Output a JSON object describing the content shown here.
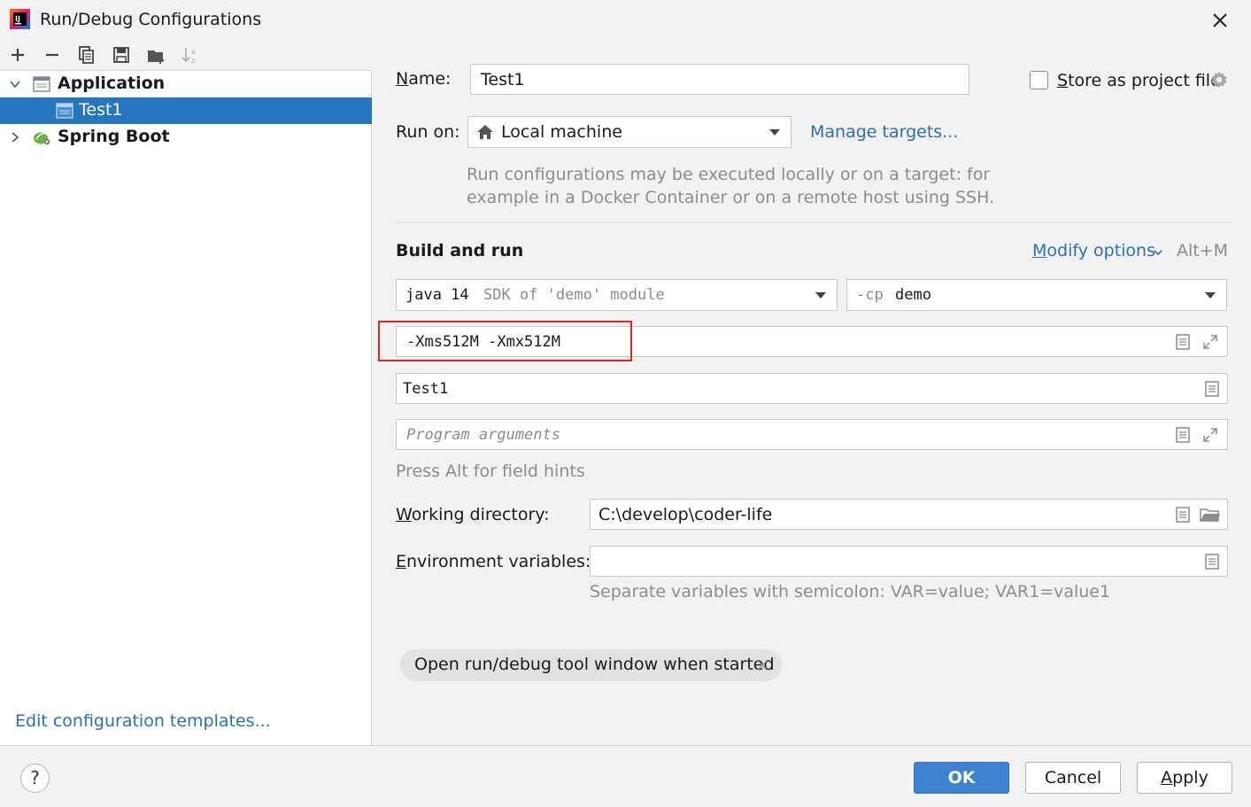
{
  "window": {
    "title": "Run/Debug Configurations"
  },
  "tree": {
    "items": [
      {
        "label": "Application",
        "expanded": true
      },
      {
        "label": "Test1",
        "selected": true
      },
      {
        "label": "Spring Boot",
        "expanded": false
      }
    ]
  },
  "edit_templates_link": "Edit configuration templates...",
  "form": {
    "name_label_mnemonic": "N",
    "name_label_rest": "ame:",
    "name_value": "Test1",
    "store_checkbox_mnemonic": "S",
    "store_checkbox_rest": "tore as project file",
    "store_checked": false,
    "run_on_label": "Run on:",
    "run_on_value": "Local machine",
    "manage_targets": "Manage targets...",
    "run_on_hint_line1": "Run configurations may be executed locally or on a target: for",
    "run_on_hint_line2": "example in a Docker Container or on a remote host using SSH.",
    "section_title": "Build and run",
    "modify_options_mnemonic": "M",
    "modify_options_rest": "odify options",
    "modify_options_shortcut": "Alt+M",
    "jre_value": "java 14",
    "jre_hint": "SDK of 'demo' module",
    "cp_prefix": "-cp",
    "cp_value": "demo",
    "vm_options_value": "-Xms512M -Xmx512M",
    "main_class_value": "Test1",
    "program_args_placeholder": "Program arguments",
    "field_hints": "Press Alt for field hints",
    "working_dir_mnemonic": "W",
    "working_dir_rest": "orking directory:",
    "working_dir_value": "C:\\develop\\coder-life",
    "env_vars_mnemonic": "E",
    "env_vars_rest": "nvironment variables:",
    "env_vars_value": "",
    "env_vars_hint": "Separate variables with semicolon: VAR=value; VAR1=value1",
    "chip_label": "Open run/debug tool window when started"
  },
  "buttons": {
    "help": "?",
    "ok": "OK",
    "cancel": "Cancel",
    "apply_mnemonic": "A",
    "apply_rest": "pply"
  },
  "colors": {
    "selection": "#2675bf",
    "link": "#2a6fb8",
    "primary_button": "#3d83cf",
    "highlight_box": "#e0242a"
  }
}
